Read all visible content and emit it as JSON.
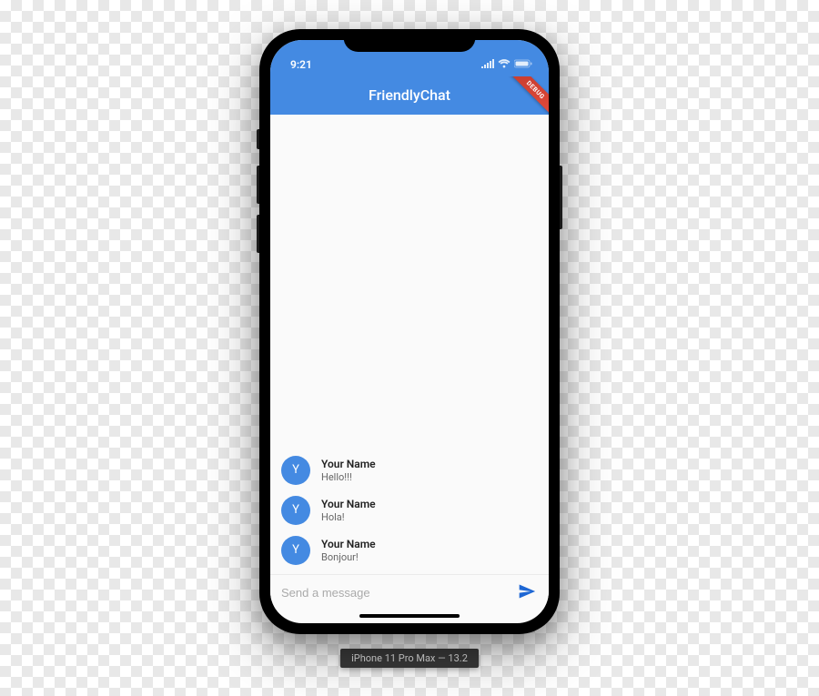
{
  "status": {
    "time": "9:21"
  },
  "debug_banner": "DEBUG",
  "appbar": {
    "title": "FriendlyChat"
  },
  "messages": [
    {
      "avatar_initial": "Y",
      "name": "Your Name",
      "text": "Hello!!!"
    },
    {
      "avatar_initial": "Y",
      "name": "Your Name",
      "text": "Hola!"
    },
    {
      "avatar_initial": "Y",
      "name": "Your Name",
      "text": "Bonjour!"
    }
  ],
  "input": {
    "placeholder": "Send a message"
  },
  "device_label": "iPhone 11 Pro Max — 13.2",
  "colors": {
    "accent": "#448AE2",
    "send_icon": "#1E67D4"
  }
}
